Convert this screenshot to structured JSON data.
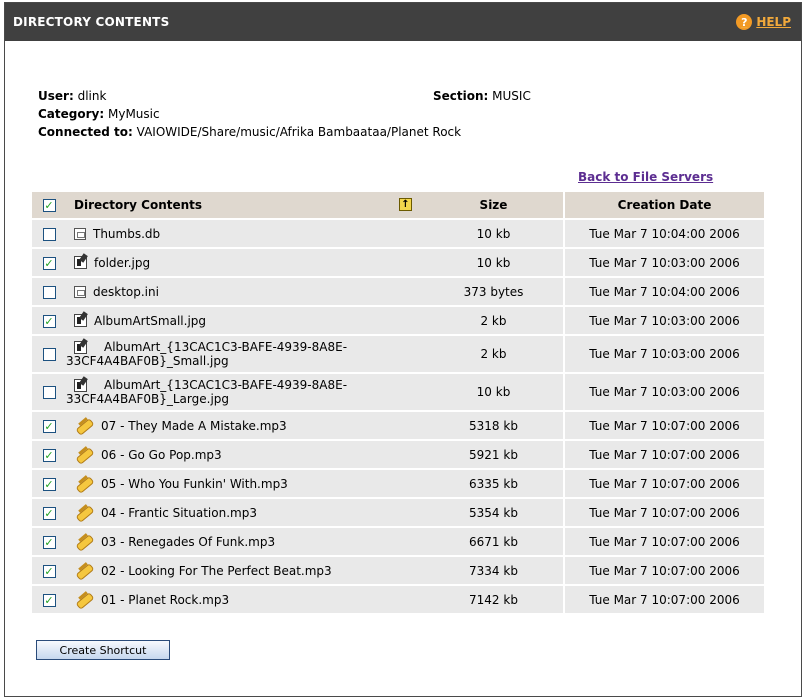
{
  "header": {
    "title": "DIRECTORY CONTENTS",
    "help_icon": "?",
    "help_label": "HELP"
  },
  "info": {
    "user_label": "User:",
    "user_value": "dlink",
    "section_label": "Section:",
    "section_value": "MUSIC",
    "category_label": "Category:",
    "category_value": "MyMusic",
    "connected_label": "Connected to:",
    "connected_value": "VAIOWIDE/Share/music/Afrika Bambaataa/Planet Rock"
  },
  "back_link": "Back to File Servers",
  "table": {
    "headers": {
      "name": "Directory Contents",
      "size": "Size",
      "date": "Creation Date"
    },
    "select_all_checked": true,
    "rows": [
      {
        "checked": false,
        "icon": "database-file-icon",
        "name": "Thumbs.db",
        "size": "10 kb",
        "date": "Tue Mar 7 10:04:00 2006"
      },
      {
        "checked": true,
        "icon": "image-file-icon",
        "name": "folder.jpg",
        "size": "10 kb",
        "date": "Tue Mar 7 10:03:00 2006"
      },
      {
        "checked": false,
        "icon": "database-file-icon",
        "name": "desktop.ini",
        "size": "373 bytes",
        "date": "Tue Mar 7 10:04:00 2006"
      },
      {
        "checked": true,
        "icon": "image-file-icon",
        "name": "AlbumArtSmall.jpg",
        "size": "2 kb",
        "date": "Tue Mar 7 10:03:00 2006"
      },
      {
        "checked": false,
        "icon": "image-file-icon",
        "name": "AlbumArt_{13CAC1C3-BAFE-4939-8A8E-33CF4A4BAF0B}_Small.jpg",
        "size": "2 kb",
        "date": "Tue Mar 7 10:03:00 2006"
      },
      {
        "checked": false,
        "icon": "image-file-icon",
        "name": "AlbumArt_{13CAC1C3-BAFE-4939-8A8E-33CF4A4BAF0B}_Large.jpg",
        "size": "10 kb",
        "date": "Tue Mar 7 10:03:00 2006"
      },
      {
        "checked": true,
        "icon": "audio-file-icon",
        "name": "07 - They Made A Mistake.mp3",
        "size": "5318 kb",
        "date": "Tue Mar 7 10:07:00 2006"
      },
      {
        "checked": true,
        "icon": "audio-file-icon",
        "name": "06 - Go Go Pop.mp3",
        "size": "5921 kb",
        "date": "Tue Mar 7 10:07:00 2006"
      },
      {
        "checked": true,
        "icon": "audio-file-icon",
        "name": "05 - Who You Funkin' With.mp3",
        "size": "6335 kb",
        "date": "Tue Mar 7 10:07:00 2006"
      },
      {
        "checked": true,
        "icon": "audio-file-icon",
        "name": "04 - Frantic Situation.mp3",
        "size": "5354 kb",
        "date": "Tue Mar 7 10:07:00 2006"
      },
      {
        "checked": true,
        "icon": "audio-file-icon",
        "name": "03 - Renegades Of Funk.mp3",
        "size": "6671 kb",
        "date": "Tue Mar 7 10:07:00 2006"
      },
      {
        "checked": true,
        "icon": "audio-file-icon",
        "name": "02 - Looking For The Perfect Beat.mp3",
        "size": "7334 kb",
        "date": "Tue Mar 7 10:07:00 2006"
      },
      {
        "checked": true,
        "icon": "audio-file-icon",
        "name": "01 - Planet Rock.mp3",
        "size": "7142 kb",
        "date": "Tue Mar 7 10:07:00 2006"
      }
    ]
  },
  "create_button": "Create Shortcut",
  "colors": {
    "titlebar": "#404040",
    "header_row": "#dfd8cf",
    "row": "#e9e9e9",
    "help": "#f29a25",
    "link": "#5c2d91"
  }
}
